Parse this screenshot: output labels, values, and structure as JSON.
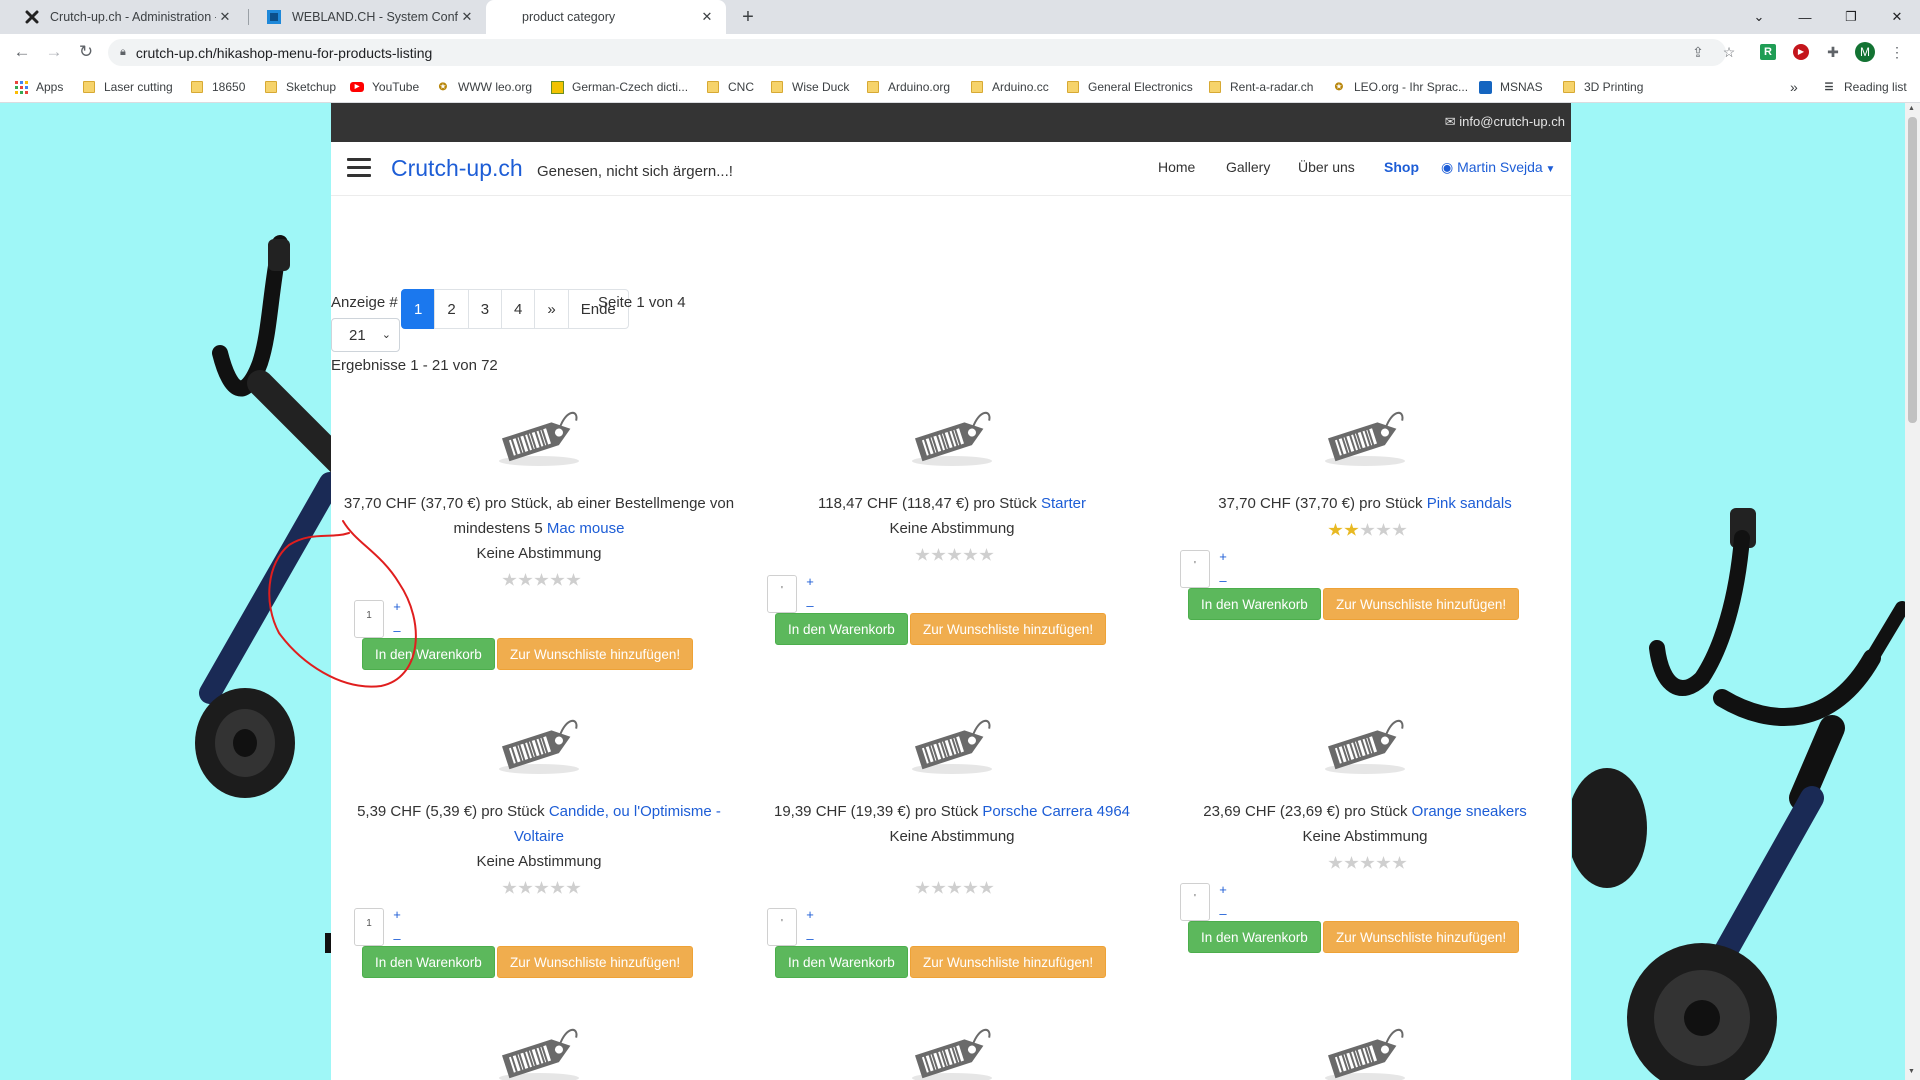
{
  "browser": {
    "tabs": [
      {
        "title": "Crutch-up.ch - Administration - C"
      },
      {
        "title": "WEBLAND.CH - System Configura"
      },
      {
        "title": "product category"
      }
    ],
    "url": "crutch-up.ch/hikashop-menu-for-products-listing",
    "profile_initial": "M",
    "ext_letter": "R",
    "bookmarks": [
      "Apps",
      "Laser cutting",
      "18650",
      "Sketchup",
      "YouTube",
      "WWW leo.org",
      "German-Czech dicti...",
      "CNC",
      "Wise Duck",
      "Arduino.org",
      "Arduino.cc",
      "General Electronics",
      "Rent-a-radar.ch",
      "LEO.org - Ihr Sprac...",
      "MSNAS",
      "3D Printing"
    ],
    "reading_list": "Reading list",
    "bookmarks_overflow": "»"
  },
  "site": {
    "email": "info@crutch-up.ch",
    "brand": "Crutch-up.ch",
    "tagline": "Genesen, nicht sich ärgern...!",
    "nav": {
      "home": "Home",
      "gallery": "Gallery",
      "about": "Über uns",
      "shop": "Shop",
      "user": "Martin Svejda"
    }
  },
  "listing": {
    "display_label": "Anzeige #",
    "pages": [
      "1",
      "2",
      "3",
      "4",
      "»",
      "Ende"
    ],
    "current_page": "1",
    "page_of": "Seite 1 von 4",
    "per_page": "21",
    "results": "Ergebnisse 1 - 21 von 72",
    "cart_label": "In den Warenkorb",
    "wish_label": "Zur Wunschliste hinzufügen!",
    "no_votes": "Keine Abstimmung",
    "plus": "+",
    "minus": "–"
  },
  "products": [
    {
      "price": "37,70 CHF (37,70 €) pro Stück, ab einer Bestellmenge von mindestens 5",
      "name": "Mac mouse",
      "votes": "Keine Abstimmung",
      "rating": 0,
      "qty": "1"
    },
    {
      "price": "118,47 CHF (118,47 €) pro Stück",
      "name": "Starter",
      "votes": "Keine Abstimmung",
      "rating": 0,
      "qty": "'"
    },
    {
      "price": "37,70 CHF (37,70 €) pro Stück",
      "name": "Pink sandals",
      "votes": "",
      "rating": 2,
      "qty": "'"
    },
    {
      "price": "5,39 CHF (5,39 €) pro Stück",
      "name": "Candide, ou l'Optimisme - Voltaire",
      "votes": "Keine Abstimmung",
      "rating": 0,
      "qty": "1"
    },
    {
      "price": "19,39 CHF (19,39 €) pro Stück",
      "name": "Porsche Carrera 4964",
      "votes": "Keine Abstimmung",
      "rating": 0,
      "qty": "'"
    },
    {
      "price": "23,69 CHF (23,69 €) pro Stück",
      "name": "Orange sneakers",
      "votes": "Keine Abstimmung",
      "rating": 0,
      "qty": "'"
    }
  ],
  "colors": {
    "accent": "#1d5dd6",
    "cart": "#5cb85c",
    "wish": "#f0ad4e",
    "background": "#9ff7f7",
    "annotation": "#e01e1e"
  }
}
